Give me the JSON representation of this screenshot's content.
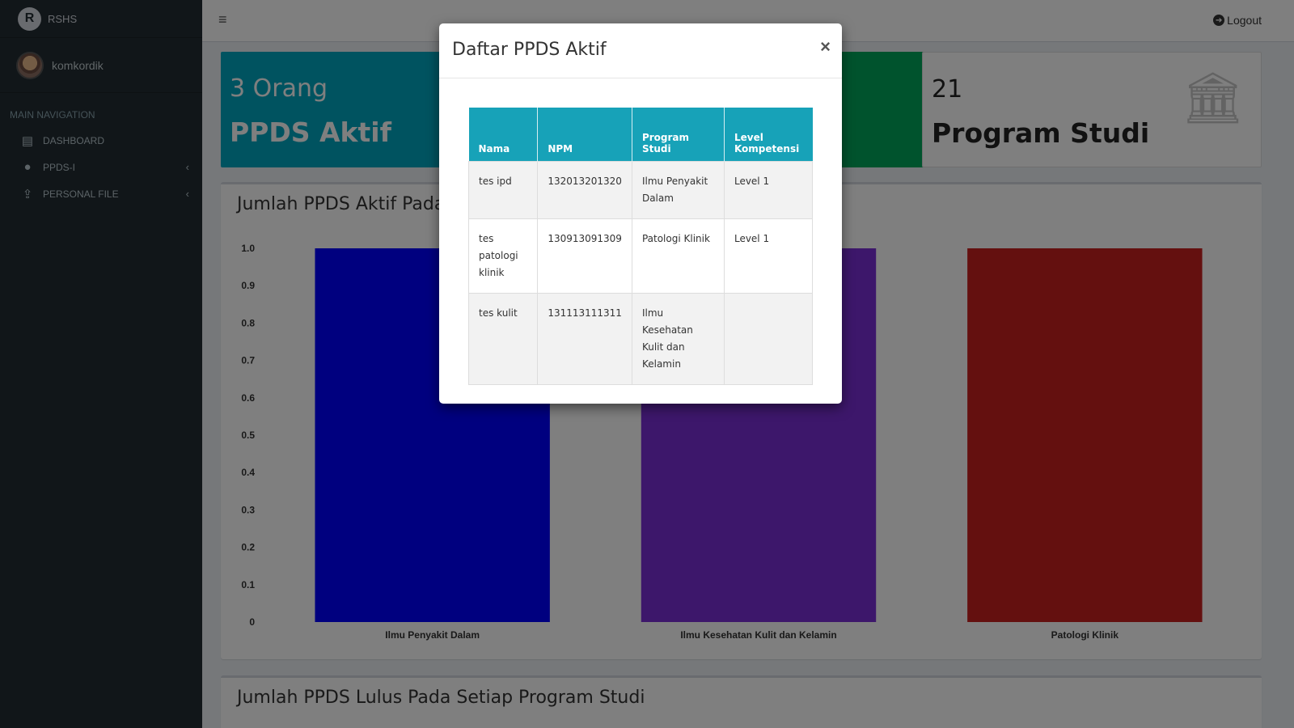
{
  "brand": {
    "logo_letter": "R",
    "name": "RSHS"
  },
  "user": {
    "name": "komkordik"
  },
  "nav": {
    "header": "MAIN NAVIGATION",
    "items": [
      {
        "label": "DASHBOARD",
        "icon": "dashboard-icon"
      },
      {
        "label": "PPDS-I",
        "icon": "user-icon"
      },
      {
        "label": "PERSONAL FILE",
        "icon": "upload-icon"
      }
    ]
  },
  "topbar": {
    "menu_symbol": "≡",
    "logout_label": "Logout"
  },
  "stats": [
    {
      "value": "3 Orang",
      "label": "PPDS Aktif"
    },
    {
      "value": "21",
      "label": "Program Studi"
    }
  ],
  "panels": {
    "active_title": "Jumlah PPDS Aktif Pada S",
    "graduated_title": "Jumlah PPDS Lulus Pada Setiap Program Studi"
  },
  "chart_data": {
    "type": "bar",
    "categories": [
      "Ilmu Penyakit Dalam",
      "Ilmu Kesehatan Kulit dan Kelamin",
      "Patologi Klinik"
    ],
    "values": [
      1,
      1,
      1
    ],
    "colors": [
      "#0000ff",
      "#7b2fd6",
      "#c8201f"
    ],
    "ylim": [
      0,
      1
    ],
    "yticks": [
      "1.0",
      "0.9",
      "0.8",
      "0.7",
      "0.6",
      "0.5",
      "0.4",
      "0.3",
      "0.2",
      "0.1",
      "0"
    ]
  },
  "modal": {
    "title": "Daftar PPDS Aktif",
    "close_symbol": "×",
    "headers": [
      "Nama",
      "NPM",
      "Program Studi",
      "Level Kompetensi"
    ],
    "rows": [
      [
        "tes ipd",
        "132013201320",
        "Ilmu Penyakit Dalam",
        "Level 1"
      ],
      [
        "tes patologi klinik",
        "130913091309",
        "Patologi Klinik",
        "Level 1"
      ],
      [
        "tes kulit",
        "131113111311",
        "Ilmu Kesehatan Kulit dan Kelamin",
        ""
      ]
    ]
  }
}
